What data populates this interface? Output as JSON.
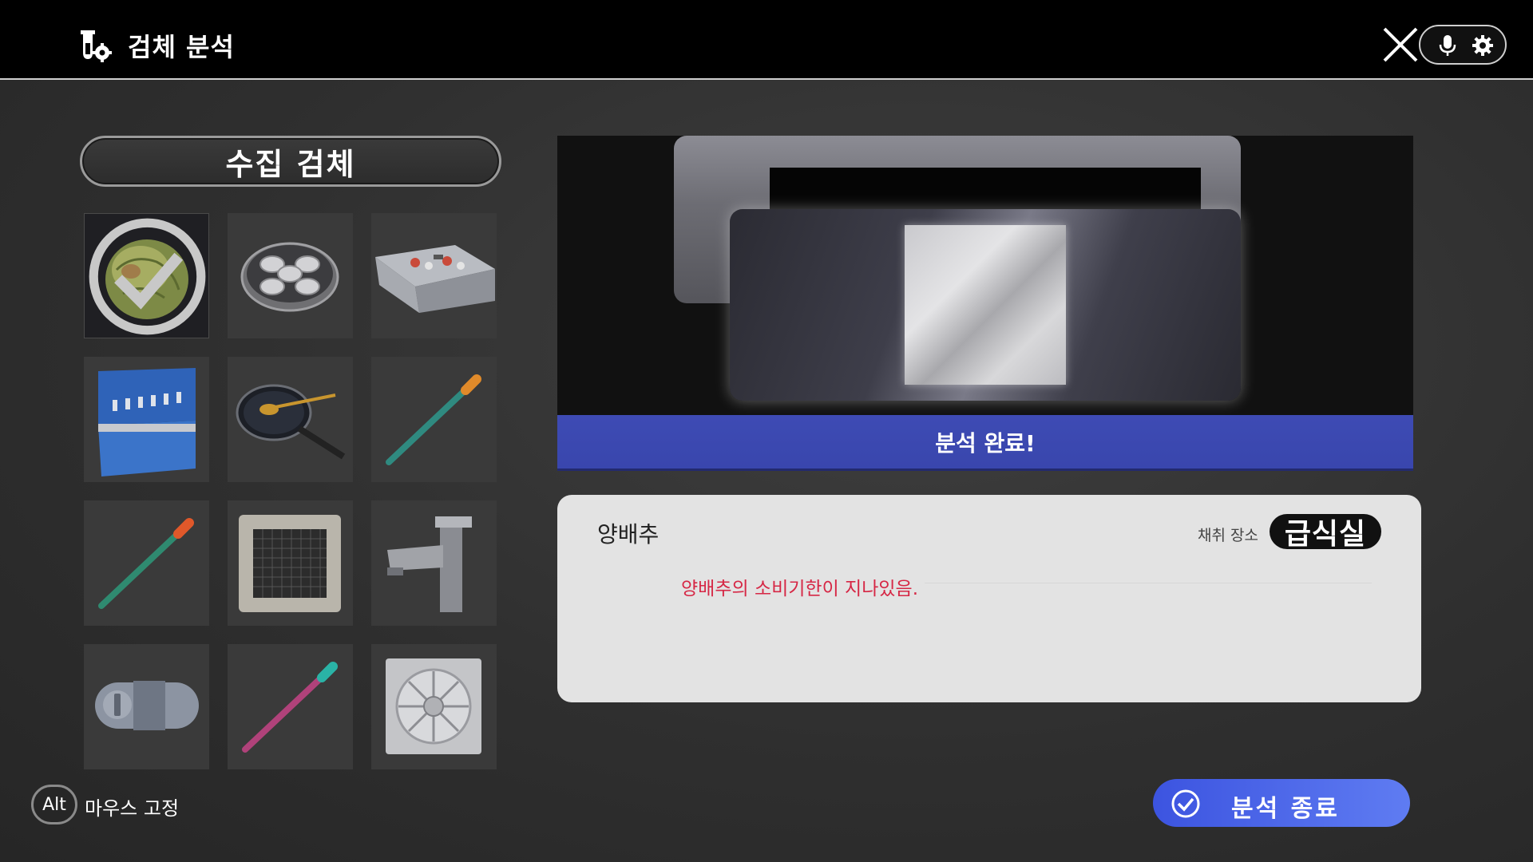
{
  "header": {
    "title": "검체 분석",
    "title_icon": "lab-gear-icon",
    "close_icon": "close-icon",
    "mic_icon": "microphone-icon",
    "settings_icon": "gear-icon"
  },
  "collection": {
    "title": "수집 검체",
    "items": [
      {
        "name": "cabbage",
        "selected": true
      },
      {
        "name": "food-container-tray",
        "selected": false
      },
      {
        "name": "serving-counter",
        "selected": false
      },
      {
        "name": "water-dispenser",
        "selected": false
      },
      {
        "name": "frying-pan-spoon",
        "selected": false
      },
      {
        "name": "swab-orange",
        "selected": false
      },
      {
        "name": "swab-red",
        "selected": false
      },
      {
        "name": "ceiling-air-vent",
        "selected": false
      },
      {
        "name": "faucet",
        "selected": false
      },
      {
        "name": "door-lock",
        "selected": false
      },
      {
        "name": "swab-teal",
        "selected": false
      },
      {
        "name": "exhaust-fan",
        "selected": false
      }
    ]
  },
  "analysis": {
    "status": "분석 완료!",
    "status_color": "#3e4bb4"
  },
  "result": {
    "sample_name": "양배추",
    "location_label": "채취 장소",
    "location": "급식실",
    "description": "양배추의 소비기한이 지나있음.",
    "description_color": "#d62745"
  },
  "footer": {
    "alt_key": "Alt",
    "alt_label": "마우스 고정",
    "end_button": "분석 종료",
    "end_icon": "check-circle-icon",
    "accent": "#4a64e8"
  }
}
